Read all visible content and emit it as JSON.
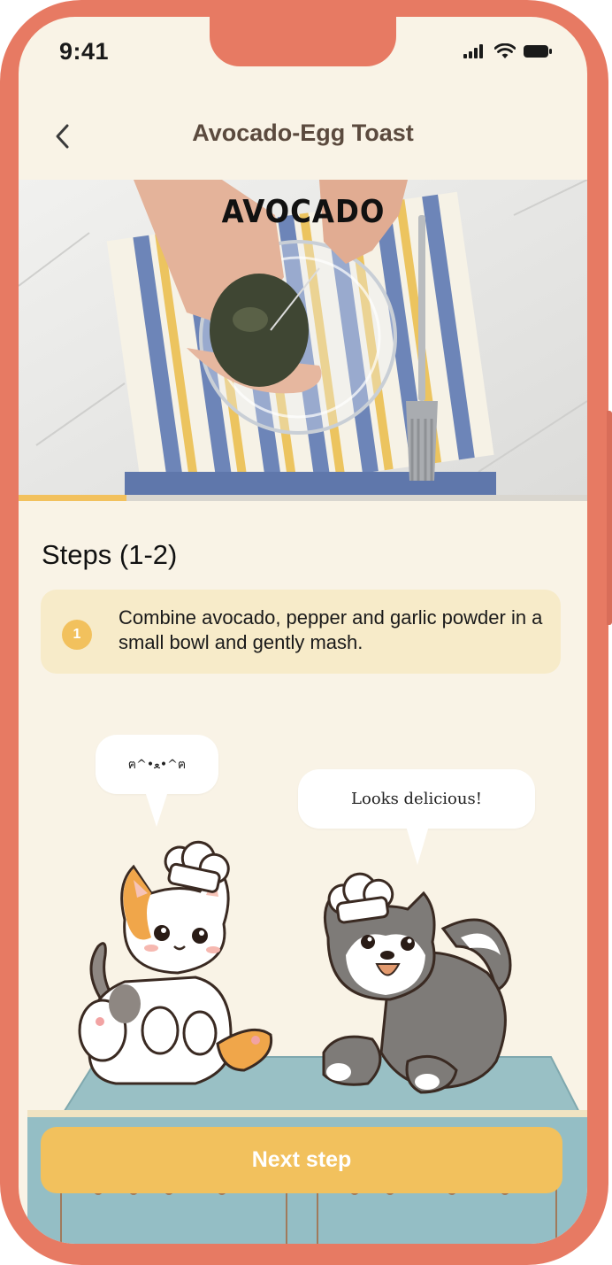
{
  "status_bar": {
    "time": "9:41",
    "icons": [
      "signal-icon",
      "wifi-icon",
      "battery-icon"
    ]
  },
  "header": {
    "back_icon": "chevron-left-icon",
    "title": "Avocado-Egg Toast"
  },
  "media": {
    "overlay_text": "AVOCADO",
    "progress": 0.19
  },
  "steps": {
    "heading": "Steps (1-2)",
    "items": [
      {
        "number": "1",
        "text": "Combine avocado, pepper and garlic powder in a small bowl and gently mash."
      }
    ]
  },
  "characters": {
    "cat_speech": "ฅ^•ﻌ•^ฅ",
    "dog_speech": "Looks delicious!"
  },
  "actions": {
    "next_label": "Next step"
  },
  "colors": {
    "frame": "#e77a63",
    "background": "#f9f3e6",
    "accent": "#f2c15d",
    "card": "#f7ebc9",
    "title_text": "#5b4a3e"
  }
}
